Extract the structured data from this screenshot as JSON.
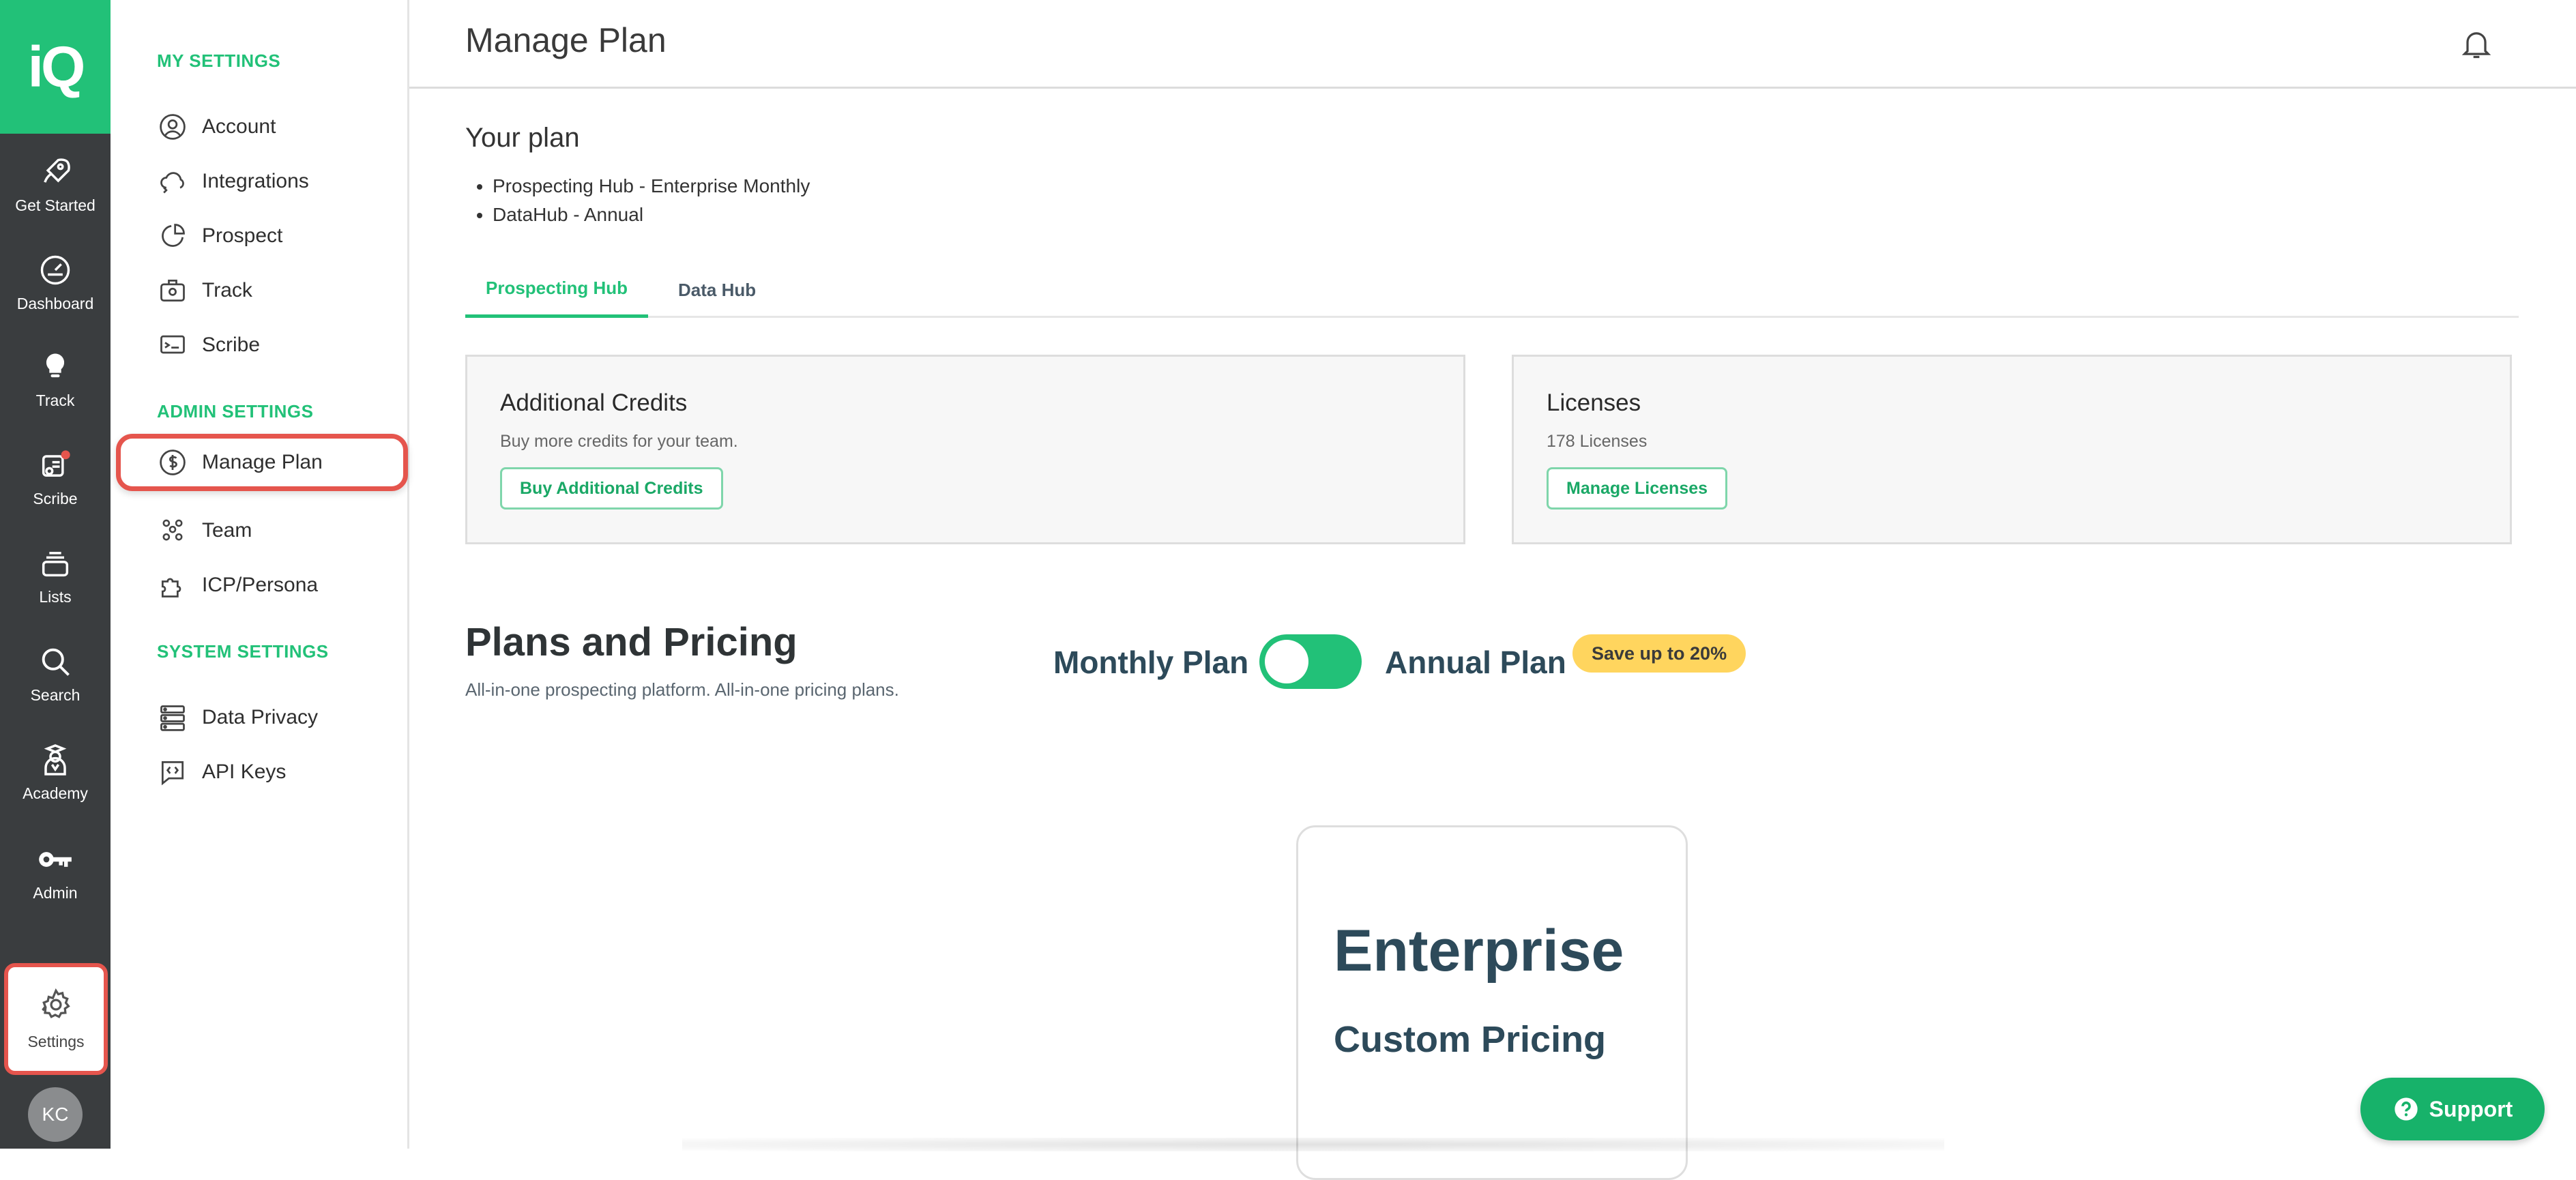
{
  "app": {
    "logo_text": "iQ"
  },
  "rail": {
    "items": [
      {
        "label": "Get Started",
        "icon": "rocket-icon"
      },
      {
        "label": "Dashboard",
        "icon": "gauge-icon"
      },
      {
        "label": "Track",
        "icon": "lightbulb-icon"
      },
      {
        "label": "Scribe",
        "icon": "scribe-icon"
      },
      {
        "label": "Lists",
        "icon": "stack-icon"
      },
      {
        "label": "Search",
        "icon": "search-icon"
      },
      {
        "label": "Academy",
        "icon": "graduate-icon"
      },
      {
        "label": "Admin",
        "icon": "key-icon"
      }
    ],
    "settings_label": "Settings",
    "avatar_initials": "KC"
  },
  "sidebar": {
    "my_settings_heading": "MY SETTINGS",
    "my_settings": [
      {
        "label": "Account",
        "icon": "user-circle-icon"
      },
      {
        "label": "Integrations",
        "icon": "cloud-sync-icon"
      },
      {
        "label": "Prospect",
        "icon": "chart-arc-icon"
      },
      {
        "label": "Track",
        "icon": "briefcase-icon"
      },
      {
        "label": "Scribe",
        "icon": "message-icon"
      }
    ],
    "admin_settings_heading": "ADMIN SETTINGS",
    "admin_settings": [
      {
        "label": "Manage Plan",
        "icon": "dollar-circle-icon"
      },
      {
        "label": "Team",
        "icon": "team-icon"
      },
      {
        "label": "ICP/Persona",
        "icon": "puzzle-icon"
      }
    ],
    "system_settings_heading": "SYSTEM SETTINGS",
    "system_settings": [
      {
        "label": "Data Privacy",
        "icon": "server-icon"
      },
      {
        "label": "API Keys",
        "icon": "code-bubble-icon"
      }
    ]
  },
  "header": {
    "title": "Manage Plan"
  },
  "your_plan": {
    "heading": "Your plan",
    "items": [
      "Prospecting Hub - Enterprise Monthly",
      "DataHub - Annual"
    ]
  },
  "tabs": {
    "active": "Prospecting Hub",
    "other": "Data Hub"
  },
  "credits_card": {
    "title": "Additional Credits",
    "subtitle": "Buy more credits for your team.",
    "button": "Buy Additional Credits"
  },
  "licenses_card": {
    "title": "Licenses",
    "subtitle": "178 Licenses",
    "button": "Manage Licenses"
  },
  "pricing": {
    "title": "Plans and Pricing",
    "subtitle": "All-in-one prospecting platform. All-in-one pricing plans.",
    "monthly_label": "Monthly Plan",
    "annual_label": "Annual Plan",
    "save_badge": "Save up to 20%"
  },
  "enterprise_card": {
    "title": "Enterprise",
    "price": "Custom Pricing"
  },
  "support": {
    "label": "Support"
  },
  "colors": {
    "brand": "#22c178",
    "rail": "#3a3d3f",
    "highlight": "#e5554d",
    "badge": "#ffd55e"
  }
}
